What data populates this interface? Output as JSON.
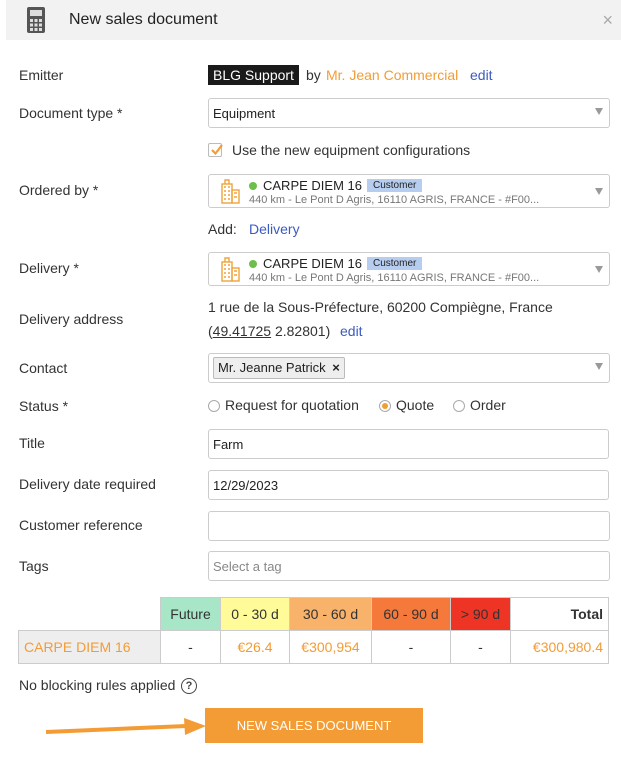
{
  "header": {
    "title": "New sales document",
    "calc_icon": "calculator-icon",
    "close_icon": "close-icon",
    "close_symbol": "×"
  },
  "labels": {
    "emitter": "Emitter",
    "document_type": "Document type *",
    "ordered_by": "Ordered by *",
    "delivery": "Delivery *",
    "delivery_address": "Delivery address",
    "contact": "Contact",
    "status": "Status *",
    "title": "Title",
    "delivery_date": "Delivery date required",
    "customer_reference": "Customer reference",
    "tags": "Tags"
  },
  "emitter": {
    "name": "BLG Support",
    "by": "by",
    "person": "Mr. Jean Commercial",
    "edit": "edit"
  },
  "document_type": {
    "value": "Equipment"
  },
  "equipment_config": {
    "checked": true,
    "label": "Use the new equipment configurations"
  },
  "ordered_by": {
    "name": "CARPE DIEM 16",
    "badge": "Customer",
    "address": "440 km - Le Pont D Agris, 16110 AGRIS, FRANCE - #F00..."
  },
  "add_row": {
    "label": "Add:",
    "link": "Delivery"
  },
  "delivery": {
    "name": "CARPE DIEM 16",
    "badge": "Customer",
    "address": "440 km - Le Pont D Agris, 16110 AGRIS, FRANCE - #F00..."
  },
  "delivery_address": {
    "line1": "1 rue de la Sous-Préfecture, 60200 Compiègne, France",
    "open_paren": "(",
    "lat": "49.41725",
    "lng": " 2.82801)",
    "edit": "edit"
  },
  "contact": {
    "chip": "Mr. Jeanne Patrick",
    "remove": "×"
  },
  "status": {
    "options": [
      "Request for quotation",
      "Quote",
      "Order"
    ],
    "selected": "Quote"
  },
  "title": {
    "value": "Farm"
  },
  "delivery_date": {
    "value": "12/29/2023"
  },
  "customer_reference": {
    "value": ""
  },
  "tags": {
    "placeholder": "Select a tag"
  },
  "aging": {
    "headers": [
      "Future",
      "0 - 30 d",
      "30 - 60 d",
      "60 - 90 d",
      "> 90 d",
      "Total"
    ],
    "header_colors": [
      "#a8e6c8",
      "#fffb99",
      "#f8b26a",
      "#f4793b",
      "#ee3424",
      "#ffffff"
    ],
    "row_label": "CARPE DIEM 16",
    "values": [
      "-",
      "€26.4",
      "€300,954",
      "-",
      "-",
      "€300,980.4"
    ]
  },
  "blocking": {
    "text": "No blocking rules applied",
    "help": "?"
  },
  "submit": {
    "label": "NEW SALES DOCUMENT"
  },
  "colors": {
    "accent": "#f39c35",
    "link": "#3b5bbf"
  }
}
